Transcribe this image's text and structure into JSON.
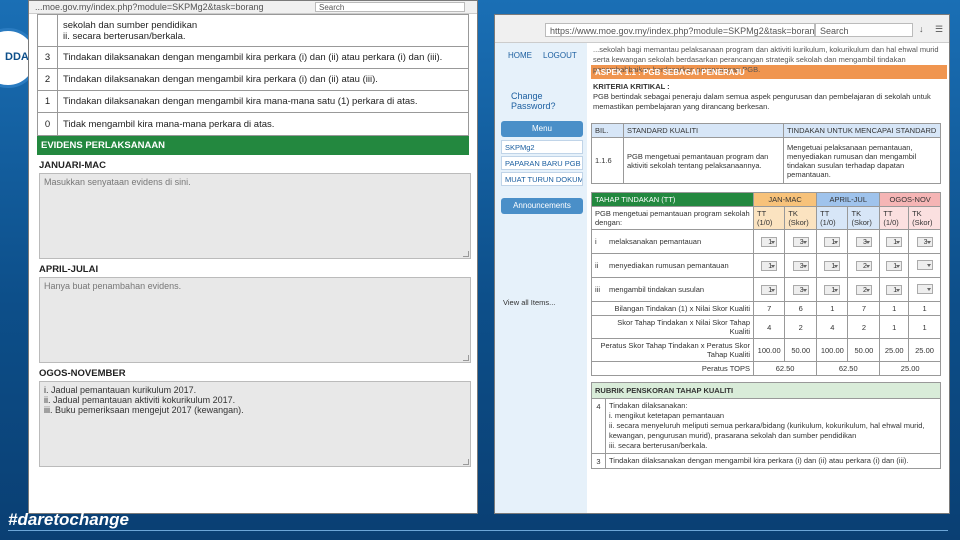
{
  "brand": {
    "logo_text": "DDA",
    "tagline": "#daretochange"
  },
  "left_window": {
    "address": "...moe.gov.my/index.php?module=SKPMg2&task=borang",
    "search_placeholder": "Search",
    "rows": [
      {
        "no": "",
        "text": "sekolah dan sumber pendidikan|ii. secara berterusan/berkala."
      },
      {
        "no": "3",
        "text": "Tindakan dilaksanakan dengan mengambil kira perkara (i) dan (ii) atau perkara (i) dan (iii)."
      },
      {
        "no": "2",
        "text": "Tindakan dilaksanakan dengan mengambil kira perkara (i) dan (ii) atau (iii)."
      },
      {
        "no": "1",
        "text": "Tindakan dilaksanakan dengan mengambil kira mana-mana satu (1) perkara di atas."
      },
      {
        "no": "0",
        "text": "Tidak mengambil kira mana-mana perkara di atas."
      }
    ],
    "evidence_header": "EVIDENS PERLAKSANAAN",
    "sections": [
      {
        "label": "JANUARI-MAC",
        "text": "Masukkan senyataan evidens di sini.",
        "filled": false
      },
      {
        "label": "APRIL-JULAI",
        "text": "Hanya buat penambahan evidens.",
        "filled": false
      },
      {
        "label": "OGOS-NOVEMBER",
        "text": "i. Jadual pemantauan kurikulum 2017.|ii. Jadual pemantauan aktiviti kokurikulum 2017.|iii. Buku pemeriksaan mengejut 2017 (kewangan).",
        "filled": true
      }
    ]
  },
  "right_window": {
    "address": "https://www.moe.gov.my/index.php?module=SKPMg2&task=borang",
    "search_placeholder": "Search",
    "sidebar": {
      "home": "HOME",
      "logout": "LOGOUT",
      "change_password": "Change Password?",
      "menu_title": "Menu",
      "menu_items": [
        "SKPMg2",
        "PAPARAN BARU PGB",
        "MUAT TURUN DOKUMEN"
      ],
      "announcements_title": "Announcements",
      "view_all": "View all Items..."
    },
    "intro_text": "...sekolah bagi memantau pelaksanaan program dan aktiviti kurikulum, kokurikulum dan hal ehwal murid serta kewangan sekolah berdasarkan perancangan strategik sekolah dan mengambil tindakan penambahbaikan berdasarkan perancangan PGB.",
    "aspect_title": "ASPEK 1.1 : PGB SEBAGAI PENERAJU",
    "criteria_label": "KRITERIA KRITIKAL :",
    "criteria_text": "PGB bertindak sebagai peneraju dalam semua aspek pengurusan dan pembelajaran di sekolah untuk memastikan pembelajaran yang dirancang berkesan.",
    "standard": {
      "headers": [
        "BIL.",
        "STANDARD KUALITI",
        "TINDAKAN UNTUK MENCAPAI STANDARD"
      ],
      "no": "1.1.6",
      "standard_text": "PGB mengetuai pemantauan program dan aktiviti sekolah tentang pelaksanaannya.",
      "action_text": "Mengetuai pelaksanaan pemantauan, menyediakan rumusan dan mengambil tindakan susulan terhadap dapatan pemantauan."
    },
    "action_table": {
      "header": "TAHAP TINDAKAN (TT)",
      "periods": [
        "JAN-MAC",
        "APRIL-JUL",
        "OGOS-NOV"
      ],
      "sub_label": "PGB mengetuai pemantauan program sekolah dengan:",
      "subcols": [
        "TT (1/0)",
        "TK (Skor)"
      ],
      "items": [
        {
          "no": "i",
          "text": "melaksanakan pemantauan",
          "vals": [
            "1",
            "3",
            "1",
            "3",
            "1",
            "3"
          ]
        },
        {
          "no": "ii",
          "text": "menyediakan rumusan pemantauan",
          "vals": [
            "1",
            "3",
            "1",
            "2",
            "1",
            ""
          ]
        },
        {
          "no": "iii",
          "text": "mengambil tindakan susulan",
          "vals": [
            "1",
            "3",
            "1",
            "2",
            "1",
            ""
          ]
        }
      ],
      "summary": [
        {
          "label": "Bilangan Tindakan (1) x Nilai Skor Kualiti",
          "vals": [
            "7",
            "6",
            "1",
            "7",
            "1",
            "1"
          ]
        },
        {
          "label": "Skor Tahap Tindakan x Nilai Skor Tahap Kualiti",
          "vals": [
            "4",
            "2",
            "4",
            "2",
            "1",
            "1"
          ]
        },
        {
          "label": "Peratus Skor Tahap Tindakan x Peratus Skor Tahap Kualiti",
          "vals": [
            "100.00",
            "50.00",
            "100.00",
            "50.00",
            "25.00",
            "25.00"
          ]
        }
      ],
      "percent_label": "Peratus TOPS",
      "percent_vals": [
        "62.50",
        "62.50",
        "25.00"
      ]
    },
    "rubric": {
      "title": "RUBRIK PENSKORAN TAHAP KUALITI",
      "rows": [
        {
          "no": "4",
          "text": "Tindakan dilaksanakan:|i. mengikut ketetapan pemantauan|ii. secara menyeluruh meliputi semua perkara/bidang (kurikulum, kokurikulum, hal ehwal murid, kewangan, pengurusan murid), prasarana sekolah dan sumber pendidikan|iii. secara berterusan/berkala."
        },
        {
          "no": "3",
          "text": "Tindakan dilaksanakan dengan mengambil kira perkara (i) dan (ii) atau perkara (i) dan (iii)."
        }
      ]
    }
  }
}
